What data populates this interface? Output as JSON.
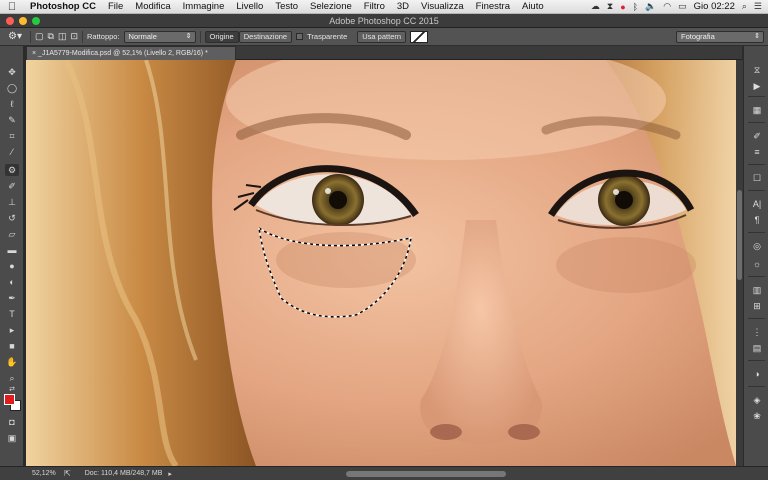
{
  "menubar": {
    "apple": "",
    "items": [
      "Photoshop CC",
      "File",
      "Modifica",
      "Immagine",
      "Livello",
      "Testo",
      "Selezione",
      "Filtro",
      "3D",
      "Visualizza",
      "Finestra",
      "Aiuto"
    ],
    "clock": "Gio 02:22"
  },
  "window": {
    "title": "Adobe Photoshop CC 2015",
    "traffic_colors": [
      "#fc5f57",
      "#fdbc2e",
      "#28c840"
    ]
  },
  "options": {
    "rattoppo_label": "Rattoppo:",
    "rattoppo_value": "Normale",
    "origine": "Origine",
    "destinazione": "Destinazione",
    "trasparente": "Trasparente",
    "usa_pattern": "Usa pattern",
    "workspace": "Fotografia"
  },
  "document": {
    "tab_title": "_J1A5779-Modifica.psd @ 52,1% (Livello 2, RGB/16) *",
    "tab_close": "×"
  },
  "status": {
    "zoom": "52,12%",
    "doc_info": "Doc: 110,4 MB/248,7 MB"
  },
  "colors": {
    "foreground": "#e01c1c",
    "background": "#ffffff"
  },
  "tools": [
    "move-icon",
    "marquee-icon",
    "lasso-icon",
    "quick-select-icon",
    "crop-icon",
    "eyedropper-icon",
    "patch-icon",
    "brush-icon",
    "stamp-icon",
    "history-brush-icon",
    "eraser-icon",
    "gradient-icon",
    "blur-icon",
    "dodge-icon",
    "pen-icon",
    "type-icon",
    "path-select-icon",
    "rectangle-icon",
    "hand-icon",
    "zoom-icon"
  ]
}
